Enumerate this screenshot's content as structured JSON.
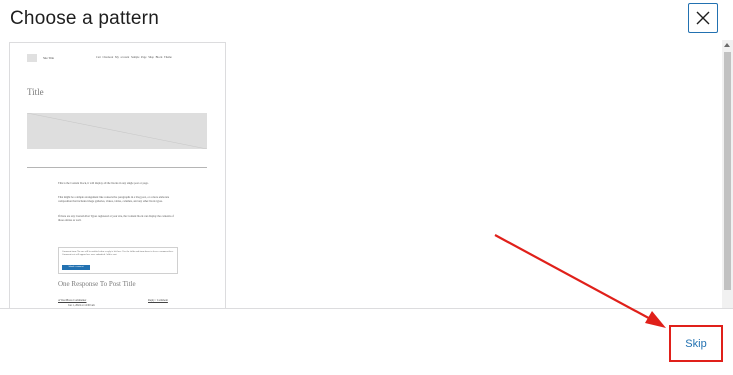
{
  "header": {
    "title": "Choose a pattern",
    "close_icon": "close-icon"
  },
  "preview": {
    "site_title": "Site Title",
    "nav_items": [
      "Cart",
      "Checkout",
      "My account",
      "Sample Page",
      "Shop",
      "Block Theme"
    ],
    "post_title": "Title",
    "paragraphs": [
      "This is the Content block, it will display all the blocks in any single post or page.",
      "That might be a simple arrangement like consecutive paragraphs in a blog post, or a more elaborate composition that includes image galleries, videos, tables, columns, and any other block types.",
      "If there are any Custom Post Types registered at your site, the Content block can display the contents of those entries as well."
    ],
    "comment_box_text": "Comment form: No one will be notified when a reply is left here. Use the fields and form above to leave a comment here. Comment text will appear here once submitted. Add to cart.",
    "comment_box_button": "Submit a comment",
    "responses_heading": "One Response To Post Title",
    "comment_author": "A WordPress Commenter",
    "comment_meta": "Reply / Comment",
    "comment_date": "Jan 1, 2024 at 12:00 am"
  },
  "footer": {
    "skip_label": "Skip"
  },
  "annotation": {
    "color": "#e0201a"
  },
  "colors": {
    "accent": "#2271b1",
    "highlight": "#e0201a"
  }
}
